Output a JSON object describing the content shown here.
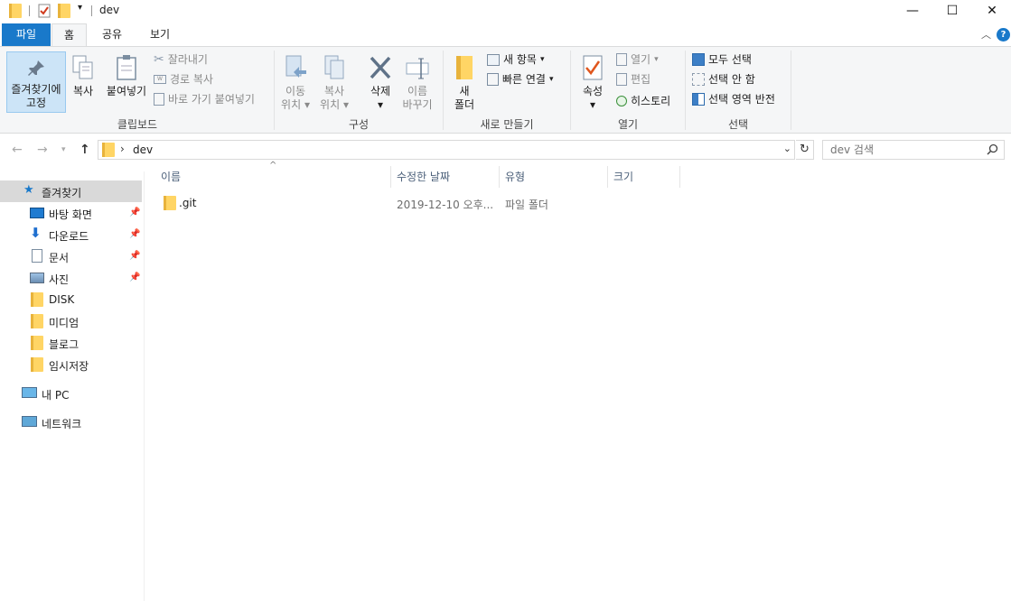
{
  "window": {
    "title": "dev",
    "minimize_glyph": "—",
    "maximize_glyph": "☐",
    "close_glyph": "✕"
  },
  "ribbon_tabs": {
    "file": "파일",
    "home": "홈",
    "share": "공유",
    "view": "보기",
    "help_glyph": "?"
  },
  "ribbon": {
    "clipboard": {
      "label": "클립보드",
      "pin_line1": "즐겨찾기에",
      "pin_line2": "고정",
      "copy": "복사",
      "paste": "붙여넣기",
      "cut": "잘라내기",
      "copy_path": "경로 복사",
      "paste_shortcut": "바로 가기 붙여넣기"
    },
    "organize": {
      "label": "구성",
      "move_line1": "이동",
      "move_line2": "위치",
      "copyto_line1": "복사",
      "copyto_line2": "위치",
      "delete": "삭제",
      "rename_line1": "이름",
      "rename_line2": "바꾸기"
    },
    "new": {
      "label": "새로 만들기",
      "new_folder_line1": "새",
      "new_folder_line2": "폴더",
      "new_item": "새 항목",
      "easy_access": "빠른 연결"
    },
    "open": {
      "label": "열기",
      "properties": "속성",
      "open": "열기",
      "edit": "편집",
      "history": "히스토리"
    },
    "select": {
      "label": "선택",
      "select_all": "모두 선택",
      "select_none": "선택 안 함",
      "invert": "선택 영역 반전"
    }
  },
  "address": {
    "path": "dev",
    "search_placeholder": "dev 검색"
  },
  "nav_pane": {
    "quick_access": "즐겨찾기",
    "items": [
      {
        "label": "바탕 화면",
        "pinned": true
      },
      {
        "label": "다운로드",
        "pinned": true
      },
      {
        "label": "문서",
        "pinned": true
      },
      {
        "label": "사진",
        "pinned": true
      },
      {
        "label": "DISK",
        "pinned": false
      },
      {
        "label": "미디엄",
        "pinned": false
      },
      {
        "label": "블로그",
        "pinned": false
      },
      {
        "label": "임시저장",
        "pinned": false
      }
    ],
    "this_pc": "내 PC",
    "network": "네트워크"
  },
  "file_list": {
    "columns": {
      "name": "이름",
      "date": "수정한 날짜",
      "type": "유형",
      "size": "크기"
    },
    "rows": [
      {
        "name": ".git",
        "date": "2019-12-10 오후...",
        "type": "파일 폴더",
        "size": ""
      }
    ]
  },
  "colors": {
    "accent": "#1979ca",
    "selected_nav": "#d9d9d9",
    "folder": "#ffd565"
  }
}
